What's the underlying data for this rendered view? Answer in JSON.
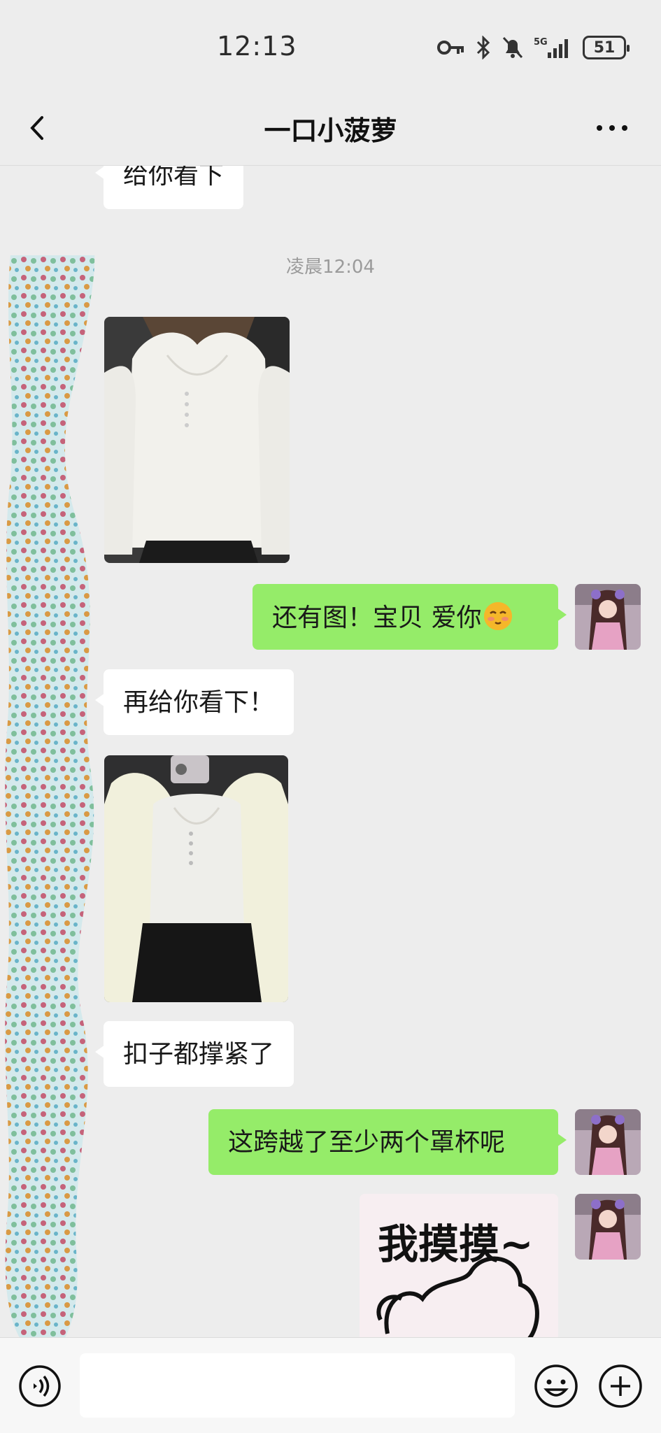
{
  "status_bar": {
    "time": "12:13",
    "network": "5G",
    "battery": "51"
  },
  "header": {
    "title": "一口小菠萝"
  },
  "chat": {
    "messages": [
      {
        "from": "them",
        "type": "text",
        "text": "给你看下"
      },
      {
        "type": "timestamp",
        "text": "凌晨12:04"
      },
      {
        "from": "them",
        "type": "image",
        "description": "photo"
      },
      {
        "from": "me",
        "type": "text",
        "text": "还有图！宝贝 爱你",
        "emoji": "blushing-face"
      },
      {
        "from": "them",
        "type": "text",
        "text": "再给你看下！"
      },
      {
        "from": "them",
        "type": "image",
        "description": "photo"
      },
      {
        "from": "them",
        "type": "text",
        "text": "扣子都撑紧了"
      },
      {
        "from": "me",
        "type": "text",
        "text": "这跨越了至少两个罩杯呢"
      },
      {
        "from": "me",
        "type": "sticker",
        "text": "我摸摸~"
      }
    ]
  },
  "input_bar": {
    "placeholder": ""
  }
}
